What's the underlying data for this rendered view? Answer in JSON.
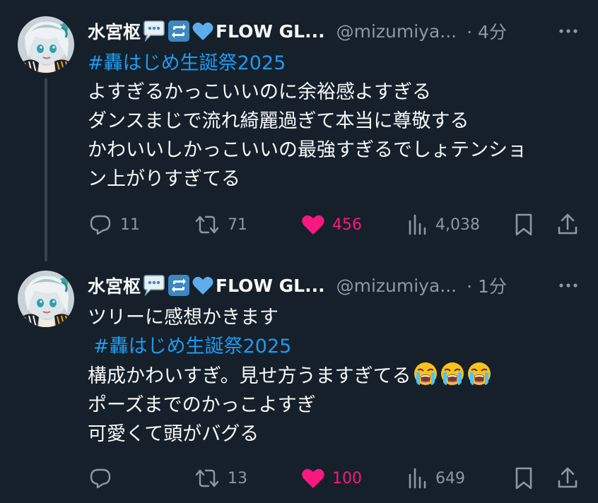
{
  "tweets": [
    {
      "author": {
        "display_name": "水宮枢",
        "name_suffix": "FLOW GL...",
        "handle": "@mizumiya...",
        "time": "· 4分"
      },
      "hashtag": "#轟はじめ生誕祭2025",
      "lines": [
        "よすぎるかっこいいのに余裕感よすぎる",
        "ダンスまじで流れ綺麗過ぎて本当に尊敬する",
        "かわいいしかっこいいの最強すぎるでしょテンショ",
        "ン上がりすぎてる"
      ],
      "actions": {
        "replies": "11",
        "reposts": "71",
        "likes": "456",
        "views": "4,038"
      }
    },
    {
      "author": {
        "display_name": "水宮枢",
        "name_suffix": "FLOW GL...",
        "handle": "@mizumiya...",
        "time": "· 1分"
      },
      "first_line": "ツリーに感想かきます",
      "hashtag": "#轟はじめ生誕祭2025",
      "lines": [
        "構成かわいすぎ。見せ方うますぎてる",
        "ポーズまでのかっこよすぎ",
        "可愛くて頭がバグる"
      ],
      "emoji": [
        "loudly-crying-face",
        "loudly-crying-face",
        "loudly-crying-face"
      ],
      "actions": {
        "replies": "",
        "reposts": "13",
        "likes": "100",
        "views": "649"
      }
    }
  ],
  "icons": {
    "name_badges": [
      "speech-bubble-icon",
      "repeat-button-icon",
      "blue-heart-icon"
    ],
    "reply": "reply-icon",
    "repost": "repost-icon",
    "like": "heart-filled-icon",
    "views": "views-icon",
    "bookmark": "bookmark-icon",
    "share": "share-icon",
    "more": "more-icon"
  },
  "colors": {
    "background": "#15202b",
    "text": "#f7f9f9",
    "secondary": "#8b98a5",
    "link": "#1d9bf0",
    "like": "#f91880",
    "thread_line": "#38444d"
  }
}
